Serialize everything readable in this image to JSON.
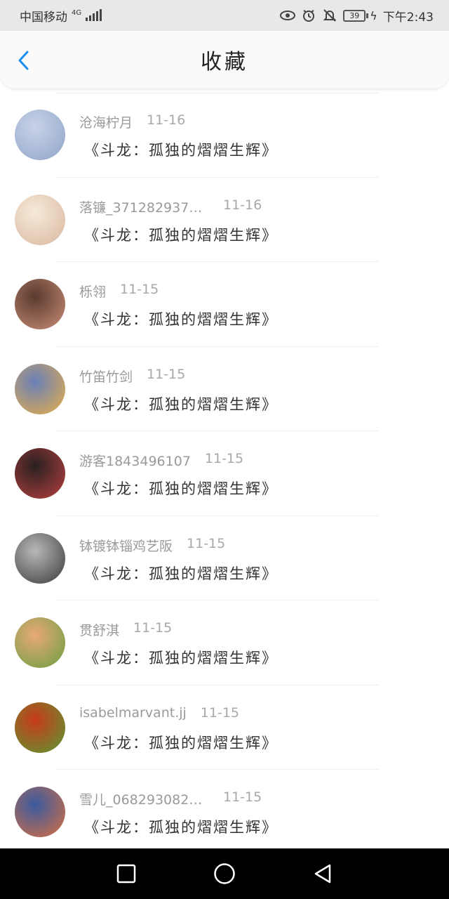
{
  "status_bar": {
    "carrier": "中国移动",
    "network": "4G",
    "battery": "39",
    "time": "下午2:43"
  },
  "header": {
    "title": "收藏",
    "back_icon": "chevron-left-icon",
    "accent": "#1a8ff0"
  },
  "favorites": [
    {
      "username": "沧海柠月",
      "date": "11-16",
      "book": "《斗龙：孤独的熠熠生辉》",
      "avatar_colors": [
        "#c9d3e8",
        "#8fa4c8"
      ]
    },
    {
      "username": "落镰_3712829376…",
      "date": "11-16",
      "book": "《斗龙：孤独的熠熠生辉》",
      "avatar_colors": [
        "#f5ead8",
        "#d9b7a0"
      ]
    },
    {
      "username": "栎翎",
      "date": "11-15",
      "book": "《斗龙：孤独的熠熠生辉》",
      "avatar_colors": [
        "#5a3a2e",
        "#c98f78"
      ]
    },
    {
      "username": "竹笛竹剑",
      "date": "11-15",
      "book": "《斗龙：孤独的熠熠生辉》",
      "avatar_colors": [
        "#6a7fb8",
        "#e8b048"
      ]
    },
    {
      "username": "游客1843496107",
      "date": "11-15",
      "book": "《斗龙：孤独的熠熠生辉》",
      "avatar_colors": [
        "#2a2020",
        "#b84040"
      ]
    },
    {
      "username": "钵镀钵锱鸡艺阪",
      "date": "11-15",
      "book": "《斗龙：孤独的熠熠生辉》",
      "avatar_colors": [
        "#b8b8b8",
        "#3a3a3a"
      ]
    },
    {
      "username": "贯舒淇",
      "date": "11-15",
      "book": "《斗龙：孤独的熠熠生辉》",
      "avatar_colors": [
        "#e8a878",
        "#6aa040"
      ]
    },
    {
      "username": "isabelmarvant.jj",
      "date": "11-15",
      "book": "《斗龙：孤独的熠熠生辉》",
      "avatar_colors": [
        "#c83a1a",
        "#5a9a30"
      ]
    },
    {
      "username": "雪儿_0682930820…",
      "date": "11-15",
      "book": "《斗龙：孤独的熠熠生辉》",
      "avatar_colors": [
        "#3a5aa0",
        "#d87040"
      ]
    }
  ],
  "nav_bar": {
    "recents_icon": "square-icon",
    "home_icon": "circle-icon",
    "back_icon": "triangle-back-icon"
  }
}
